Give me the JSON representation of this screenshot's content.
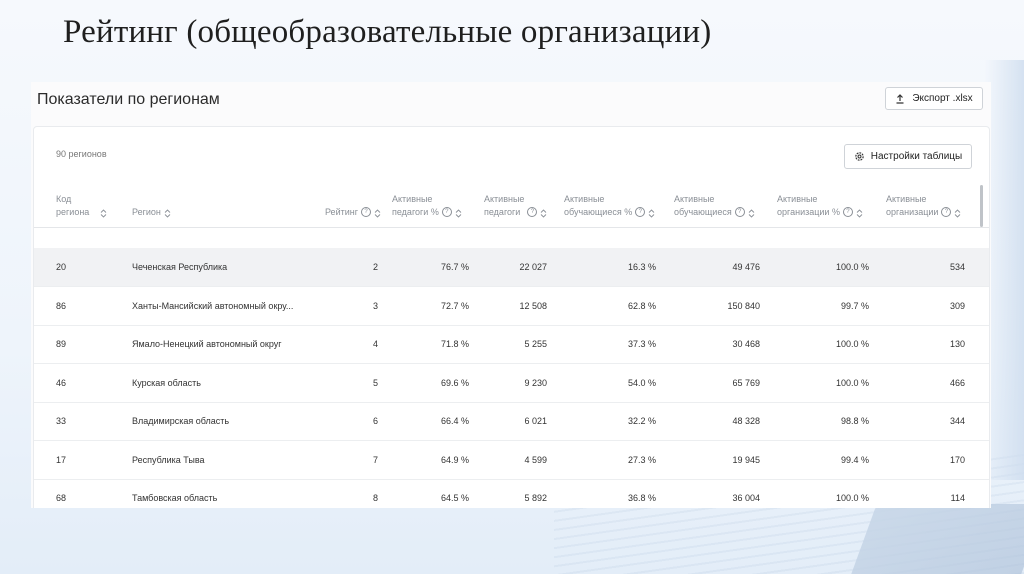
{
  "slide": {
    "title": "Рейтинг (общеобразовательные организации)"
  },
  "panel": {
    "title": "Показатели по регионам",
    "export_label": "Экспорт .xlsx",
    "count_label": "90 регионов",
    "settings_label": "Настройки таблицы"
  },
  "table": {
    "columns": [
      {
        "key": "code",
        "label": "Код\nрегиона"
      },
      {
        "key": "region",
        "label": "Регион"
      },
      {
        "key": "rating",
        "label": "Рейтинг"
      },
      {
        "key": "teachers_pct",
        "label": "Активные\nпедагоги %"
      },
      {
        "key": "teachers",
        "label": "Активные\nпедагоги"
      },
      {
        "key": "students_pct",
        "label": "Активные\nобучающиеся %"
      },
      {
        "key": "students",
        "label": "Активные\nобучающиеся"
      },
      {
        "key": "orgs_pct",
        "label": "Активные\nорганизации %"
      },
      {
        "key": "orgs",
        "label": "Активные\nорганизации"
      }
    ],
    "rows": [
      {
        "code": "20",
        "region": "Чеченская Республика",
        "rating": "2",
        "teachers_pct": "76.7 %",
        "teachers": "22 027",
        "students_pct": "16.3 %",
        "students": "49 476",
        "orgs_pct": "100.0 %",
        "orgs": "534"
      },
      {
        "code": "86",
        "region": "Ханты-Мансийский автономный окру...",
        "rating": "3",
        "teachers_pct": "72.7 %",
        "teachers": "12 508",
        "students_pct": "62.8 %",
        "students": "150 840",
        "orgs_pct": "99.7 %",
        "orgs": "309"
      },
      {
        "code": "89",
        "region": "Ямало-Ненецкий автономный округ",
        "rating": "4",
        "teachers_pct": "71.8 %",
        "teachers": "5 255",
        "students_pct": "37.3 %",
        "students": "30 468",
        "orgs_pct": "100.0 %",
        "orgs": "130"
      },
      {
        "code": "46",
        "region": "Курская область",
        "rating": "5",
        "teachers_pct": "69.6 %",
        "teachers": "9 230",
        "students_pct": "54.0 %",
        "students": "65 769",
        "orgs_pct": "100.0 %",
        "orgs": "466"
      },
      {
        "code": "33",
        "region": "Владимирская область",
        "rating": "6",
        "teachers_pct": "66.4 %",
        "teachers": "6 021",
        "students_pct": "32.2 %",
        "students": "48 328",
        "orgs_pct": "98.8 %",
        "orgs": "344"
      },
      {
        "code": "17",
        "region": "Республика Тыва",
        "rating": "7",
        "teachers_pct": "64.9 %",
        "teachers": "4 599",
        "students_pct": "27.3 %",
        "students": "19 945",
        "orgs_pct": "99.4 %",
        "orgs": "170"
      },
      {
        "code": "68",
        "region": "Тамбовская область",
        "rating": "8",
        "teachers_pct": "64.5 %",
        "teachers": "5 892",
        "students_pct": "36.8 %",
        "students": "36 004",
        "orgs_pct": "100.0 %",
        "orgs": "114"
      }
    ]
  }
}
